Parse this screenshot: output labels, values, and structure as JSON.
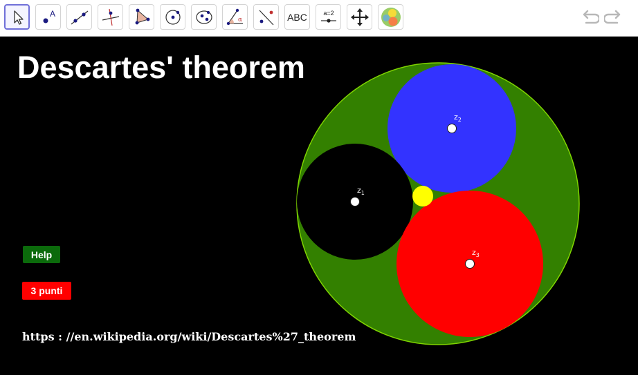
{
  "toolbar": {
    "tools": [
      {
        "name": "move-tool",
        "icon": "arrow-pointer-icon"
      },
      {
        "name": "point-tool",
        "icon": "point-icon",
        "label": "A"
      },
      {
        "name": "line-tool",
        "icon": "line-through-points-icon"
      },
      {
        "name": "perpendicular-line-tool",
        "icon": "perpendicular-line-icon"
      },
      {
        "name": "polygon-tool",
        "icon": "polygon-icon"
      },
      {
        "name": "circle-tool",
        "icon": "circle-center-point-icon"
      },
      {
        "name": "conic-tool",
        "icon": "circle-three-points-icon"
      },
      {
        "name": "angle-tool",
        "icon": "angle-icon",
        "label": "α"
      },
      {
        "name": "reflect-tool",
        "icon": "reflect-about-line-icon"
      },
      {
        "name": "text-tool",
        "icon": "text-icon",
        "label": "ABC"
      },
      {
        "name": "slider-tool",
        "icon": "slider-icon",
        "label": "a=2"
      },
      {
        "name": "move-graphics-view-tool",
        "icon": "move-arrows-icon"
      },
      {
        "name": "custom-tool",
        "icon": "descartes-thumbnail-icon"
      }
    ],
    "undo_icon": "undo-icon",
    "redo_icon": "redo-icon"
  },
  "page": {
    "title": "Descartes' theorem",
    "help_label": "Help",
    "points_label": "3 punti",
    "url_text": "https : //en.wikipedia.org/wiki/Descartes%27_theorem"
  },
  "circles": {
    "outer_color": "#338000",
    "outer_stroke": "#7fd400",
    "z1": {
      "label": "z",
      "index": "1",
      "color": "#000000"
    },
    "z2": {
      "label": "z",
      "index": "2",
      "color": "#3333ff"
    },
    "z3": {
      "label": "z",
      "index": "3",
      "color": "#ff0000"
    },
    "inner_color": "#ffff00"
  },
  "colors": {
    "help_button": "#0b6a0b",
    "points_button": "#ff0000",
    "selected_tool_border": "#6f6fd8"
  }
}
